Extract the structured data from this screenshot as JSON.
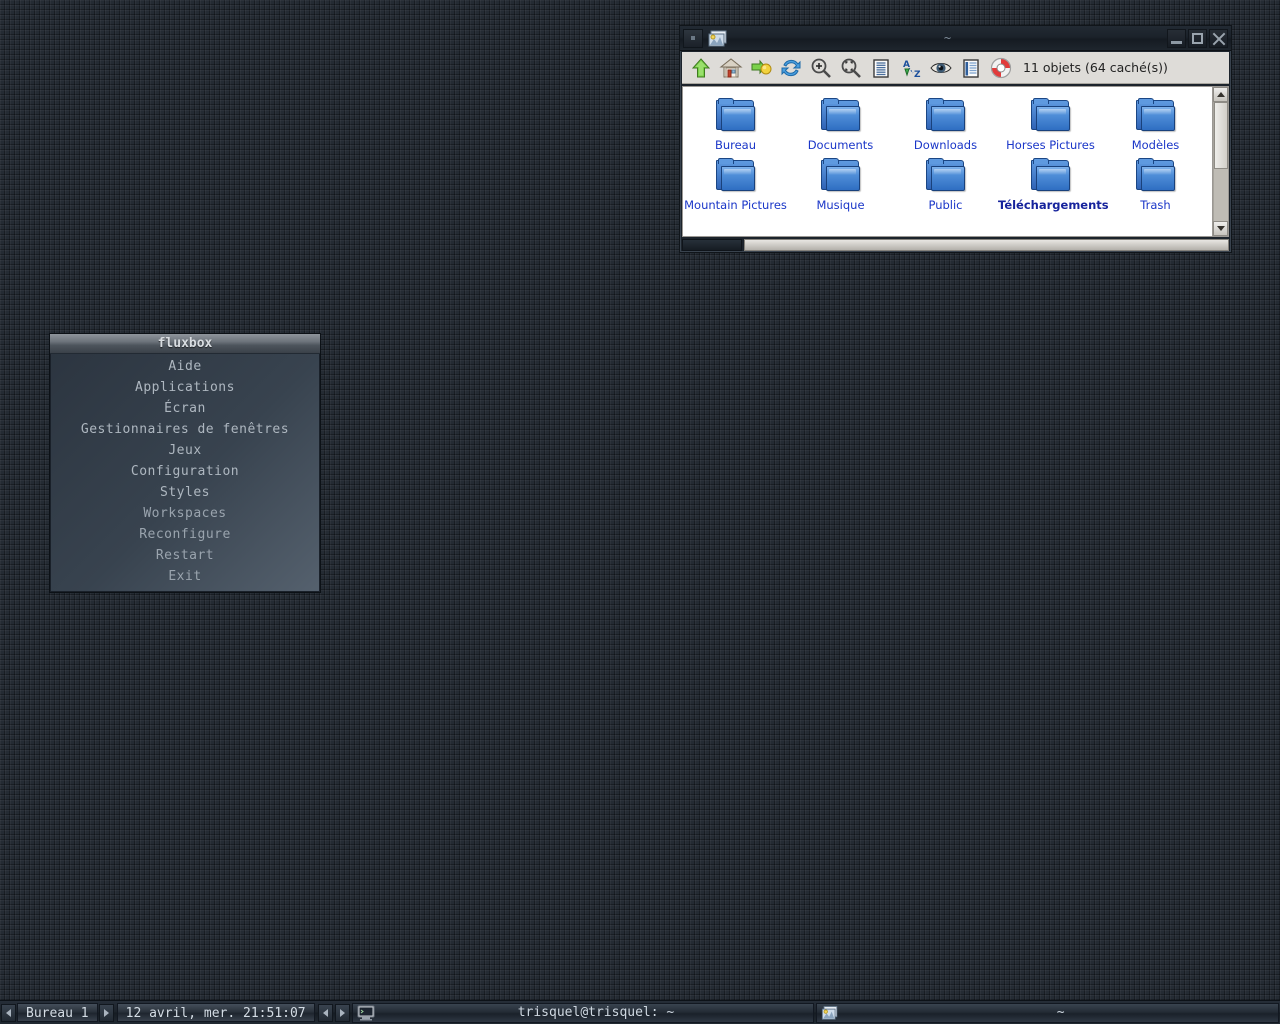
{
  "desktop": {
    "background_color": "#242b33"
  },
  "file_manager": {
    "window_title": "~",
    "titlebar_icon": "image-viewer-icon",
    "window_buttons": [
      {
        "name": "minimize-button",
        "glyph": "minimize"
      },
      {
        "name": "maximize-button",
        "glyph": "maximize"
      },
      {
        "name": "close-button",
        "glyph": "close"
      }
    ],
    "toolbar": [
      {
        "name": "go-up-icon",
        "label": "Up"
      },
      {
        "name": "go-home-icon",
        "label": "Home"
      },
      {
        "name": "go-forward-icon",
        "label": "Forward"
      },
      {
        "name": "refresh-icon",
        "label": "Refresh"
      },
      {
        "name": "zoom-in-icon",
        "label": "Zoom In"
      },
      {
        "name": "zoom-fit-icon",
        "label": "Zoom Fit"
      },
      {
        "name": "list-view-icon",
        "label": "List View"
      },
      {
        "name": "sort-az-icon",
        "label": "Sort A-Z"
      },
      {
        "name": "show-hidden-icon",
        "label": "Show Hidden"
      },
      {
        "name": "detail-view-icon",
        "label": "Detail View"
      },
      {
        "name": "lifebuoy-icon",
        "label": "Help"
      }
    ],
    "status_text": "11 objets (64 caché(s))",
    "rows": [
      [
        {
          "label": "Bureau",
          "selected": false
        },
        {
          "label": "Documents",
          "selected": false
        },
        {
          "label": "Downloads",
          "selected": false
        },
        {
          "label": "Horses Pictures",
          "selected": false
        },
        {
          "label": "Modèles",
          "selected": false
        }
      ],
      [
        {
          "label": "Mountain Pictures",
          "selected": false
        },
        {
          "label": "Musique",
          "selected": false
        },
        {
          "label": "Public",
          "selected": false
        },
        {
          "label": "Téléchargements",
          "selected": true
        },
        {
          "label": "Trash",
          "selected": false
        }
      ]
    ]
  },
  "fluxbox_menu": {
    "title": "fluxbox",
    "items": [
      {
        "label": "Aide"
      },
      {
        "label": "Applications"
      },
      {
        "label": "Écran"
      },
      {
        "label": "Gestionnaires de fenêtres"
      },
      {
        "label": "Jeux"
      },
      {
        "label": "Configuration"
      },
      {
        "label": "Styles"
      },
      {
        "label": "Workspaces"
      },
      {
        "label": "Reconfigure"
      },
      {
        "label": "Restart"
      },
      {
        "label": "Exit"
      }
    ]
  },
  "taskbar": {
    "workspace_prev": "◄",
    "workspace_label": "Bureau 1",
    "workspace_next": "►",
    "clock": "12 avril, mer. 21:51:07",
    "task_prev": "◄",
    "task_next": "►",
    "tasks": [
      {
        "label": "trisquel@trisquel: ~",
        "icon": "terminal-icon"
      },
      {
        "label": "~",
        "icon": "image-viewer-icon"
      }
    ]
  }
}
